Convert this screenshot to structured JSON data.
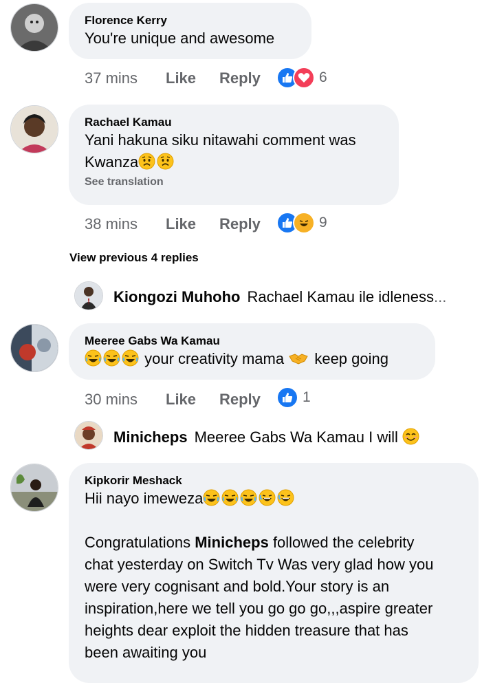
{
  "comments": [
    {
      "author": "Florence Kerry",
      "text": "You're unique and awesome",
      "time": "37 mins",
      "like_label": "Like",
      "reply_label": "Reply",
      "reaction_count": "6",
      "reactions": [
        "like-icon",
        "love-icon"
      ]
    },
    {
      "author": "Rachael Kamau",
      "text_line1": "Yani hakuna siku nitawahi comment was",
      "text_line2": "Kwanza",
      "text_emojis": [
        "worried-face-emoji",
        "worried-face-emoji"
      ],
      "see_translation": "See translation",
      "time": "38 mins",
      "like_label": "Like",
      "reply_label": "Reply",
      "reaction_count": "9",
      "reactions": [
        "like-icon",
        "haha-icon"
      ]
    },
    {
      "author": "Meeree Gabs Wa Kamau",
      "lead_emojis": [
        "rofl-emoji",
        "rofl-emoji",
        "rofl-emoji"
      ],
      "text_part1": "your creativity mama",
      "mid_emoji": "handshake-emoji",
      "text_part2": "keep going",
      "time": "30 mins",
      "like_label": "Like",
      "reply_label": "Reply",
      "reaction_count": "1",
      "reactions": [
        "like-icon"
      ]
    },
    {
      "author": "Kipkorir Meshack",
      "text_line1": "Hii nayo imeweza",
      "text_emojis": [
        "rofl-emoji",
        "rofl-emoji",
        "rofl-emoji",
        "grinning-sweat-emoji",
        "grinning-sweat-emoji"
      ],
      "para_prefix": "Congratulations",
      "para_bold": "Minicheps",
      "para_suffix": "followed the celebrity",
      "para_lines": [
        "chat yesterday on Switch Tv Was very glad how you",
        "were very cognisant  and bold.Your story is an",
        "inspiration,here we tell you go go go,,,aspire greater",
        "heights dear exploit the hidden treasure that has",
        "been awaiting you"
      ]
    }
  ],
  "view_previous": "View previous 4 replies",
  "replies": [
    {
      "name": "Kiongozi Muhoho",
      "text": "Rachael Kamau ile idleness",
      "ellipsis": "..."
    },
    {
      "name": "Minicheps",
      "text": "Meeree Gabs Wa Kamau I will",
      "emoji": "smiling-face-emoji"
    }
  ],
  "colors": {
    "bubble": "#f0f2f5",
    "meta_text": "#65676b",
    "like_blue": "#1877f2",
    "love_red": "#f33e58",
    "haha_yellow": "#f7b125"
  }
}
